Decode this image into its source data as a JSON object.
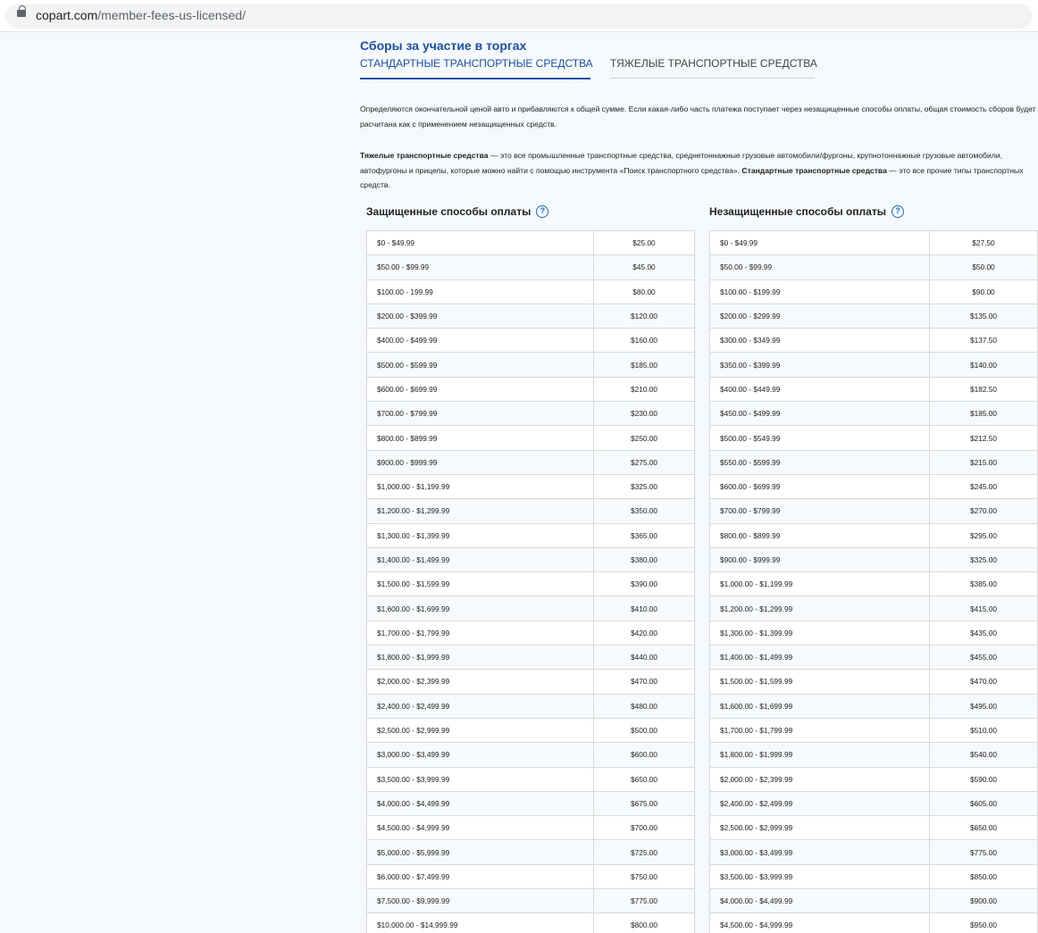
{
  "browser": {
    "url_domain": "copart.com",
    "url_path": "/member-fees-us-licensed/"
  },
  "page": {
    "title": "Сборы за участие в торгах",
    "tabs": [
      {
        "label": "СТАНДАРТНЫЕ ТРАНСПОРТНЫЕ СРЕДСТВА",
        "active": true
      },
      {
        "label": "ТЯЖЕЛЫЕ ТРАНСПОРТНЫЕ СРЕДСТВА",
        "active": false
      }
    ],
    "intro": "Определяются окончательной ценой авто и прибавляются к общей сумме. Если какая-либо часть платежа поступает через незащищенные способы оплаты, общая стоимость сборов будет расчитана как с применением незащищенных средств.",
    "definition": {
      "heavy_term": "Тяжелые транспортные средства",
      "heavy_text": " — это все промышленные транспортные средства, среднетоннажные грузовые автомобили/фургоны, крупнотоннажные грузовые автомобили, автофургоны и прицепы, которые можно найти с помощью инструмента «Поиск транспортного средства». ",
      "standard_term": "Стандартные транспортные средства",
      "standard_text": " — это все прочие типы транспортных средств."
    },
    "secured": {
      "title": "Защищенные способы оплаты",
      "help_icon": "question-circle-icon",
      "rows": [
        {
          "range": "$0 - $49.99",
          "fee": "$25.00"
        },
        {
          "range": "$50.00 - $99.99",
          "fee": "$45.00"
        },
        {
          "range": "$100.00 - 199.99",
          "fee": "$80.00"
        },
        {
          "range": "$200.00 - $399.99",
          "fee": "$120.00"
        },
        {
          "range": "$400.00 - $499.99",
          "fee": "$160.00"
        },
        {
          "range": "$500.00 - $599.99",
          "fee": "$185.00"
        },
        {
          "range": "$600.00 - $699.99",
          "fee": "$210.00"
        },
        {
          "range": "$700.00 - $799.99",
          "fee": "$230.00"
        },
        {
          "range": "$800.00 - $899.99",
          "fee": "$250.00"
        },
        {
          "range": "$900.00 - $999.99",
          "fee": "$275.00"
        },
        {
          "range": "$1,000.00 - $1,199.99",
          "fee": "$325.00"
        },
        {
          "range": "$1,200.00 - $1,299.99",
          "fee": "$350.00"
        },
        {
          "range": "$1,300.00 - $1,399.99",
          "fee": "$365.00"
        },
        {
          "range": "$1,400.00 - $1,499.99",
          "fee": "$380.00"
        },
        {
          "range": "$1,500.00 - $1,599.99",
          "fee": "$390.00"
        },
        {
          "range": "$1,600.00 - $1,699.99",
          "fee": "$410.00"
        },
        {
          "range": "$1,700.00 - $1,799.99",
          "fee": "$420.00"
        },
        {
          "range": "$1,800.00 - $1,999.99",
          "fee": "$440.00"
        },
        {
          "range": "$2,000.00 - $2,399.99",
          "fee": "$470.00"
        },
        {
          "range": "$2,400.00 - $2,499.99",
          "fee": "$480.00"
        },
        {
          "range": "$2,500.00 - $2,999.99",
          "fee": "$500.00"
        },
        {
          "range": "$3,000.00 - $3,499.99",
          "fee": "$600.00"
        },
        {
          "range": "$3,500.00 - $3,999.99",
          "fee": "$650.00"
        },
        {
          "range": "$4,000.00 - $4,499.99",
          "fee": "$675.00"
        },
        {
          "range": "$4,500.00 - $4,999.99",
          "fee": "$700.00"
        },
        {
          "range": "$5,000.00 - $5,999.99",
          "fee": "$725.00"
        },
        {
          "range": "$6,000.00 - $7,499.99",
          "fee": "$750.00"
        },
        {
          "range": "$7,500.00 - $9,999.99",
          "fee": "$775.00"
        },
        {
          "range": "$10,000.00 - $14,999.99",
          "fee": "$800.00"
        }
      ]
    },
    "unsecured": {
      "title": "Незащищенные способы оплаты",
      "help_icon": "question-circle-icon",
      "rows": [
        {
          "range": "$0 - $49.99",
          "fee": "$27.50"
        },
        {
          "range": "$50.00 - $99.99",
          "fee": "$50.00"
        },
        {
          "range": "$100.00 - $199.99",
          "fee": "$90.00"
        },
        {
          "range": "$200.00 - $299.99",
          "fee": "$135.00"
        },
        {
          "range": "$300.00 - $349.99",
          "fee": "$137.50"
        },
        {
          "range": "$350.00 - $399.99",
          "fee": "$140.00"
        },
        {
          "range": "$400.00 - $449.99",
          "fee": "$182.50"
        },
        {
          "range": "$450.00 - $499.99",
          "fee": "$185.00"
        },
        {
          "range": "$500.00 - $549.99",
          "fee": "$212.50"
        },
        {
          "range": "$550.00 - $599.99",
          "fee": "$215.00"
        },
        {
          "range": "$600.00 - $699.99",
          "fee": "$245.00"
        },
        {
          "range": "$700.00 - $799.99",
          "fee": "$270.00"
        },
        {
          "range": "$800.00 - $899.99",
          "fee": "$295.00"
        },
        {
          "range": "$900.00 - $999.99",
          "fee": "$325.00"
        },
        {
          "range": "$1,000.00 - $1,199.99",
          "fee": "$385.00"
        },
        {
          "range": "$1,200.00 - $1,299.99",
          "fee": "$415.00"
        },
        {
          "range": "$1,300.00 - $1,399.99",
          "fee": "$435.00"
        },
        {
          "range": "$1,400.00 - $1,499.99",
          "fee": "$455.00"
        },
        {
          "range": "$1,500.00 - $1,599.99",
          "fee": "$470.00"
        },
        {
          "range": "$1,600.00 - $1,699.99",
          "fee": "$495.00"
        },
        {
          "range": "$1,700.00 - $1,799.99",
          "fee": "$510.00"
        },
        {
          "range": "$1,800.00 - $1,999.99",
          "fee": "$540.00"
        },
        {
          "range": "$2,000.00 - $2,399.99",
          "fee": "$590.00"
        },
        {
          "range": "$2,400.00 - $2,499.99",
          "fee": "$605.00"
        },
        {
          "range": "$2,500.00 - $2,999.99",
          "fee": "$650.00"
        },
        {
          "range": "$3,000.00 - $3,499.99",
          "fee": "$775.00"
        },
        {
          "range": "$3,500.00 - $3,999.99",
          "fee": "$850.00"
        },
        {
          "range": "$4,000.00 - $4,499.99",
          "fee": "$900.00"
        },
        {
          "range": "$4,500.00 - $4,999.99",
          "fee": "$950.00"
        }
      ]
    },
    "colors": {
      "accent": "#1a4fa8",
      "help": "#1a6cd0",
      "background": "#f5f9fc"
    }
  }
}
